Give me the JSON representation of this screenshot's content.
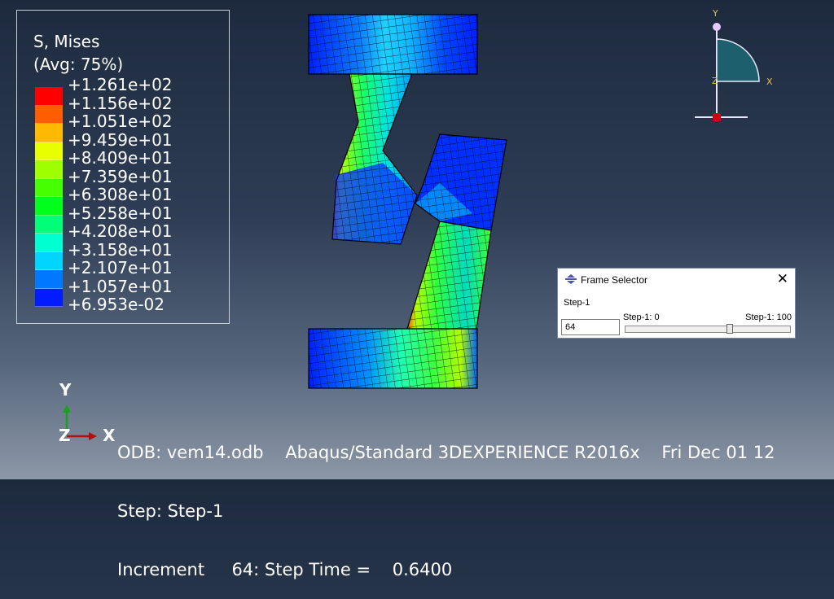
{
  "legend": {
    "title_line1": "S, Mises",
    "title_line2": "(Avg: 75%)",
    "values": [
      "+1.261e+02",
      "+1.156e+02",
      "+1.051e+02",
      "+9.459e+01",
      "+8.409e+01",
      "+7.359e+01",
      "+6.308e+01",
      "+5.258e+01",
      "+4.208e+01",
      "+3.158e+01",
      "+2.107e+01",
      "+1.057e+01",
      "+6.953e-02"
    ],
    "colors": [
      "#ff0000",
      "#ff5d00",
      "#ffb900",
      "#e8ff00",
      "#9dff00",
      "#46ff00",
      "#00ff1b",
      "#00ff78",
      "#00ffd1",
      "#00d4ff",
      "#0078ff",
      "#001cff",
      "#0000ff"
    ]
  },
  "triad_top": {
    "y_label": "Y",
    "z_label": "Z",
    "x_label": "X"
  },
  "triad_bottom": {
    "y_label": "Y",
    "z_label": "Z",
    "x_label": "X"
  },
  "info": {
    "line1": "ODB: vem14.odb    Abaqus/Standard 3DEXPERIENCE R2016x    Fri Dec 01 12",
    "line2": "Step: Step-1",
    "line3": "Increment     64: Step Time =    0.6400"
  },
  "frame_selector": {
    "title": "Frame Selector",
    "close_glyph": "✕",
    "step_label": "Step-1",
    "frame_value": "64",
    "slider_min_label": "Step-1: 0",
    "slider_max_label": "Step-1: 100",
    "slider_value": 64,
    "slider_max": 100
  }
}
